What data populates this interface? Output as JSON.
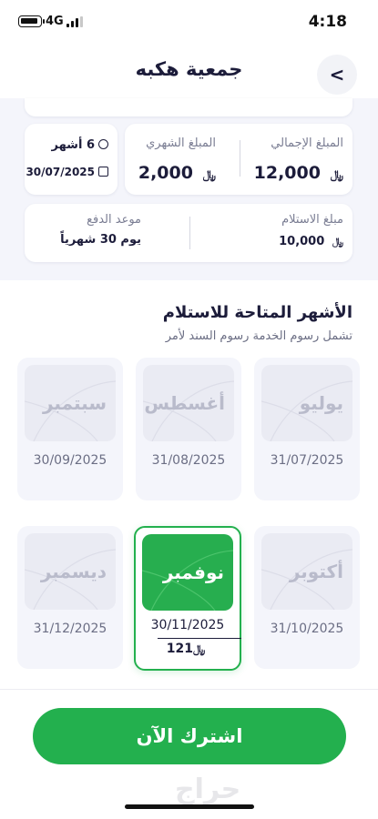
{
  "status_bar": {
    "network": "4G",
    "time": "4:18"
  },
  "header": {
    "title": "جمعية هكبه",
    "back_glyph": "<"
  },
  "summary": {
    "total_label": "المبلغ الإجمالي",
    "total_value": "12,000",
    "monthly_label": "المبلغ الشهري",
    "monthly_value": "2,000",
    "duration": "6 أشهر",
    "end_date": "30/07/2025",
    "receipt_label": "مبلغ الاستلام",
    "receipt_value": "10,000",
    "payment_label": "موعد الدفع",
    "payment_value": "يوم 30 شهرياً",
    "currency_symbol": "﷼"
  },
  "section": {
    "title": "الأشهر المتاحة للاستلام",
    "subtitle": "تشمل رسوم الخدمة رسوم السند لأمر"
  },
  "months": [
    {
      "name": "يوليو",
      "date": "31/07/2025",
      "selected": false
    },
    {
      "name": "أغسطس",
      "date": "31/08/2025",
      "selected": false
    },
    {
      "name": "سبتمبر",
      "date": "30/09/2025",
      "selected": false
    },
    {
      "name": "أكتوبر",
      "date": "31/10/2025",
      "selected": false
    },
    {
      "name": "نوفمبر",
      "date": "30/11/2025",
      "amount": "121",
      "selected": true
    },
    {
      "name": "ديسمبر",
      "date": "31/12/2025",
      "selected": false
    }
  ],
  "cta": {
    "label": "اشترك الآن"
  },
  "watermark": "حراج",
  "colors": {
    "accent": "#23b04e",
    "text": "#1c1c3a",
    "muted": "#7a7d93",
    "panel": "#f4f5fb"
  },
  "icons": [
    "back-chevron-icon",
    "clock-icon",
    "calendar-icon",
    "riyal-icon"
  ]
}
